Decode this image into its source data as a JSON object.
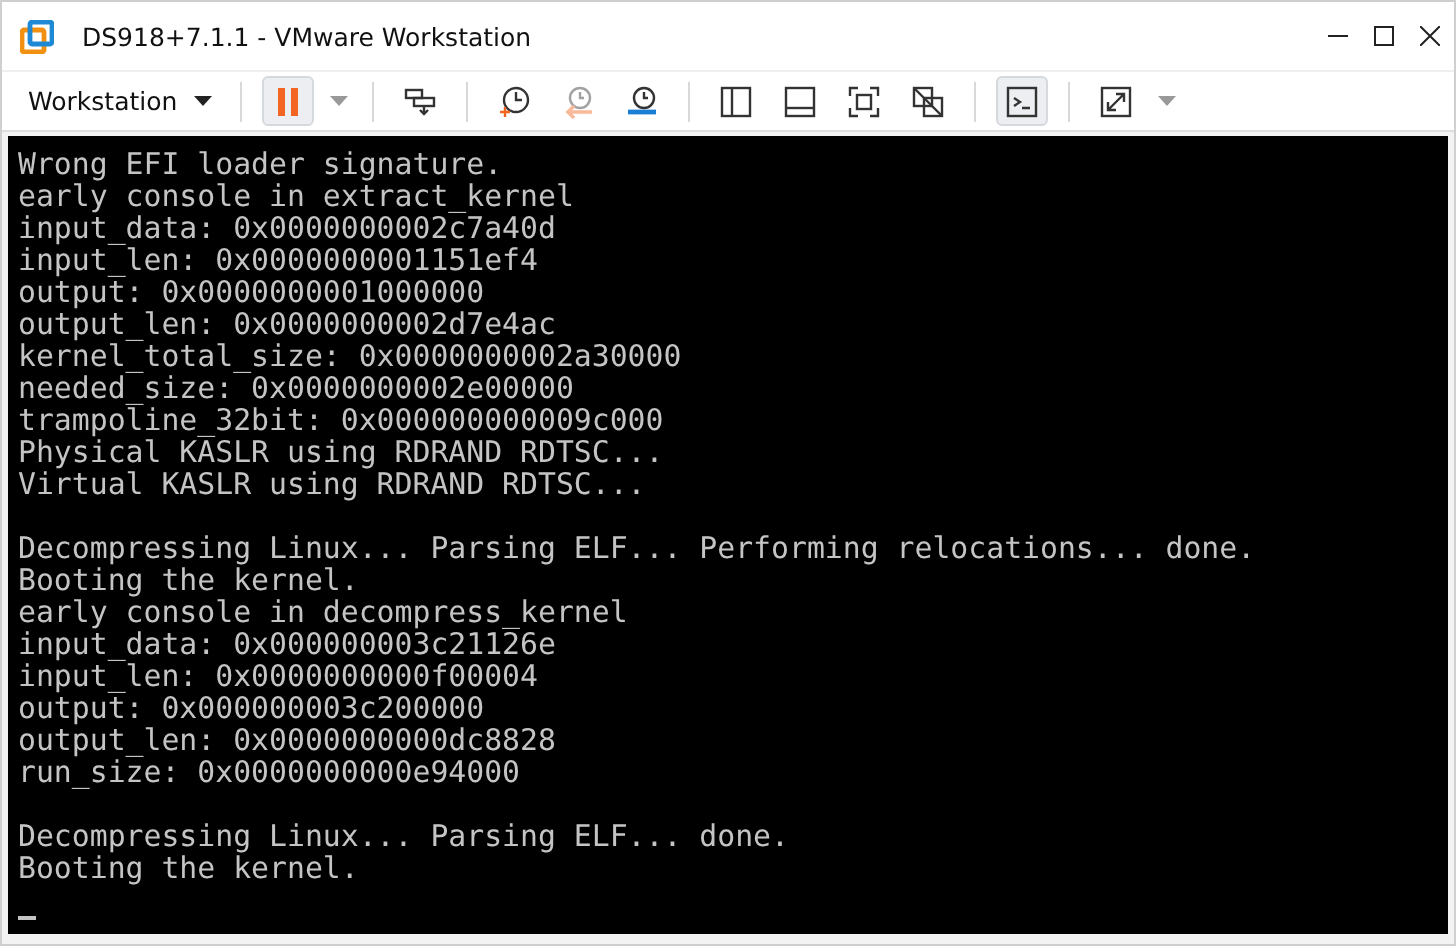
{
  "window": {
    "title": "DS918+7.1.1 - VMware Workstation"
  },
  "toolbar": {
    "menu_label": "Workstation",
    "groups": [
      [
        {
          "kind": "pause",
          "selected": true,
          "disabled": false,
          "has_menu": true
        }
      ],
      [
        {
          "kind": "send-keys",
          "selected": false,
          "disabled": false
        }
      ],
      [
        {
          "kind": "snapshot-take",
          "selected": false,
          "disabled": false
        },
        {
          "kind": "snapshot-revert",
          "selected": false,
          "disabled": true
        },
        {
          "kind": "snapshot-manage",
          "selected": false,
          "disabled": false
        }
      ],
      [
        {
          "kind": "sidebar",
          "selected": false,
          "disabled": false
        },
        {
          "kind": "thumbnail-bar",
          "selected": false,
          "disabled": false
        },
        {
          "kind": "fullscreen",
          "selected": false,
          "disabled": false
        },
        {
          "kind": "unity",
          "selected": false,
          "disabled": false
        }
      ],
      [
        {
          "kind": "console",
          "selected": true,
          "disabled": false
        }
      ],
      [
        {
          "kind": "stretch",
          "selected": false,
          "disabled": false,
          "has_menu": true
        }
      ]
    ]
  },
  "console": {
    "blocks": [
      [
        "Wrong EFI loader signature.",
        "early console in extract_kernel",
        "input_data: 0x0000000002c7a40d",
        "input_len: 0x0000000001151ef4",
        "output: 0x0000000001000000",
        "output_len: 0x0000000002d7e4ac",
        "kernel_total_size: 0x0000000002a30000",
        "needed_size: 0x0000000002e00000",
        "trampoline_32bit: 0x000000000009c000",
        "Physical KASLR using RDRAND RDTSC...",
        "Virtual KASLR using RDRAND RDTSC..."
      ],
      [
        "Decompressing Linux... Parsing ELF... Performing relocations... done.",
        "Booting the kernel.",
        "early console in decompress_kernel",
        "input_data: 0x000000003c21126e",
        "input_len: 0x0000000000f00004",
        "output: 0x000000003c200000",
        "output_len: 0x0000000000dc8828",
        "run_size: 0x0000000000e94000"
      ],
      [
        "Decompressing Linux... Parsing ELF... done.",
        "Booting the kernel."
      ]
    ],
    "cursor_visible": true
  }
}
